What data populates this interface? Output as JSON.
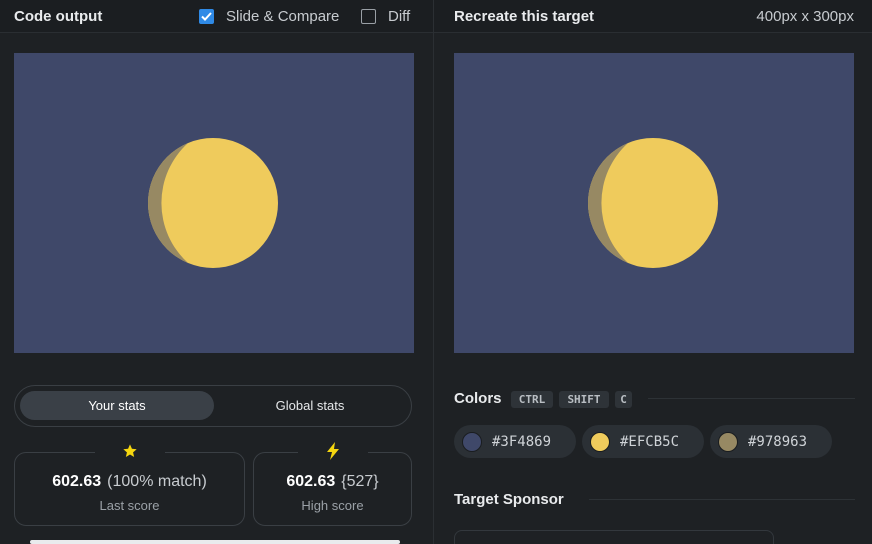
{
  "left": {
    "title": "Code output",
    "slide_compare": {
      "label": "Slide & Compare",
      "checked": true
    },
    "diff": {
      "label": "Diff",
      "checked": false
    },
    "stats_tabs": {
      "your": "Your stats",
      "global": "Global stats",
      "active": "your"
    },
    "stats": [
      {
        "icon": "star-icon",
        "value": "602.63",
        "detail": "(100% match)",
        "label": "Last score"
      },
      {
        "icon": "lightning-icon",
        "value": "602.63",
        "detail": "{527}",
        "label": "High score"
      }
    ]
  },
  "right": {
    "title": "Recreate this target",
    "dimensions": "400px x 300px",
    "colors_title": "Colors",
    "shortcut_keys": [
      "CTRL",
      "SHIFT",
      "C"
    ],
    "swatches": [
      {
        "hex": "#3F4869",
        "color": "#3f4869"
      },
      {
        "hex": "#EFCB5C",
        "color": "#efcb5c"
      },
      {
        "hex": "#978963",
        "color": "#978963"
      }
    ],
    "sponsor_title": "Target Sponsor"
  },
  "colors": {
    "background": "#3f4869",
    "moon": "#efcb5c",
    "shadow": "#978963",
    "accent": "#2f8ae6",
    "star": "#f5d60f"
  }
}
